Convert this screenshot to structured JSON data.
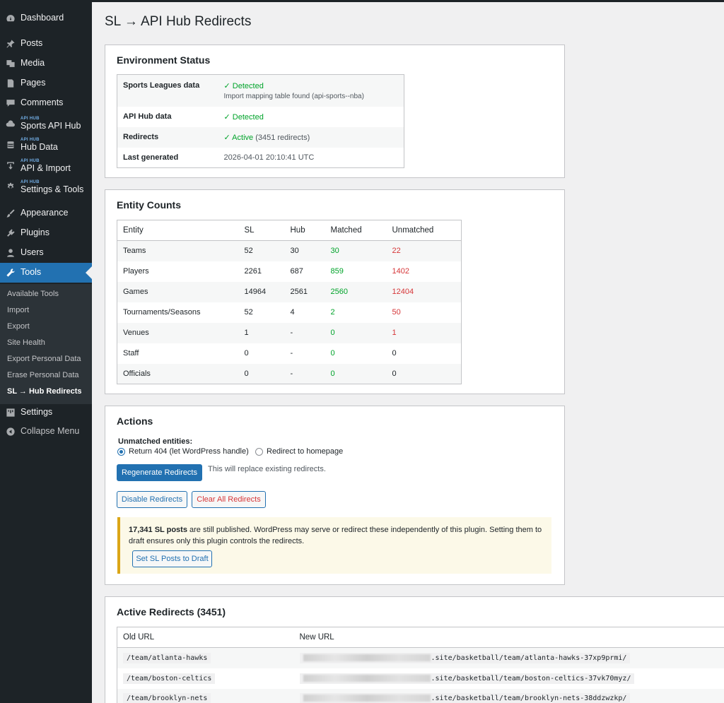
{
  "sidebar": {
    "items": [
      {
        "label": "Dashboard",
        "tag": "",
        "icon": "dashboard-icon"
      },
      {
        "label": "Posts",
        "tag": "",
        "icon": "pin-icon"
      },
      {
        "label": "Media",
        "tag": "",
        "icon": "media-icon"
      },
      {
        "label": "Pages",
        "tag": "",
        "icon": "page-icon"
      },
      {
        "label": "Comments",
        "tag": "",
        "icon": "comment-icon"
      },
      {
        "label": "Sports API Hub",
        "tag": "API HUB",
        "icon": "cloud-icon"
      },
      {
        "label": "Hub Data",
        "tag": "API HUB",
        "icon": "database-icon"
      },
      {
        "label": "API & Import",
        "tag": "API HUB",
        "icon": "download-icon"
      },
      {
        "label": "Settings & Tools",
        "tag": "API HUB",
        "icon": "gear-icon"
      },
      {
        "label": "Appearance",
        "tag": "",
        "icon": "brush-icon"
      },
      {
        "label": "Plugins",
        "tag": "",
        "icon": "plugin-icon"
      },
      {
        "label": "Users",
        "tag": "",
        "icon": "user-icon"
      },
      {
        "label": "Tools",
        "tag": "",
        "icon": "wrench-icon"
      },
      {
        "label": "Settings",
        "tag": "",
        "icon": "sliders-icon"
      },
      {
        "label": "Collapse Menu",
        "tag": "",
        "icon": "collapse-icon"
      }
    ],
    "submenu": [
      "Available Tools",
      "Import",
      "Export",
      "Site Health",
      "Export Personal Data",
      "Erase Personal Data",
      "SL → Hub Redirects"
    ]
  },
  "page": {
    "title": "SL → API Hub Redirects"
  },
  "environment": {
    "title": "Environment Status",
    "rows": [
      {
        "label": "Sports Leagues data",
        "value": "Detected",
        "note": "Import mapping table found (api-sports--nba)"
      },
      {
        "label": "API Hub data",
        "value": "Detected"
      },
      {
        "label": "Redirects",
        "value": "Active",
        "extra": "(3451 redirects)"
      },
      {
        "label": "Last generated",
        "value": "2026-04-01 20:10:41 UTC"
      }
    ]
  },
  "entity": {
    "title": "Entity Counts",
    "headers": [
      "Entity",
      "SL",
      "Hub",
      "Matched",
      "Unmatched"
    ],
    "rows": [
      [
        "Teams",
        "52",
        "30",
        "30",
        "22"
      ],
      [
        "Players",
        "2261",
        "687",
        "859",
        "1402"
      ],
      [
        "Games",
        "14964",
        "2561",
        "2560",
        "12404"
      ],
      [
        "Tournaments/Seasons",
        "52",
        "4",
        "2",
        "50"
      ],
      [
        "Venues",
        "1",
        "-",
        "0",
        "1"
      ],
      [
        "Staff",
        "0",
        "-",
        "0",
        "0"
      ],
      [
        "Officials",
        "0",
        "-",
        "0",
        "0"
      ]
    ]
  },
  "actions": {
    "title": "Actions",
    "unmatched_label": "Unmatched entities:",
    "radio_404": "Return 404 (let WordPress handle)",
    "radio_home": "Redirect to homepage",
    "regenerate": "Regenerate Redirects",
    "regenerate_note": "This will replace existing redirects.",
    "disable": "Disable Redirects",
    "clear": "Clear All Redirects",
    "notice_bold": "17,341 SL posts",
    "notice_text_1": "are still published. WordPress may serve or redirect these independently of this plugin. Setting them to",
    "notice_text_2": "draft ensures only this plugin controls the redirects.",
    "notice_button": "Set SL Posts to Draft"
  },
  "redirects": {
    "title": "Active Redirects (3451)",
    "headers": [
      "Old URL",
      "New URL"
    ],
    "rows": [
      {
        "old": "/team/atlanta-hawks",
        "new": ".site/basketball/team/atlanta-hawks-37xp9prmi/"
      },
      {
        "old": "/team/boston-celtics",
        "new": ".site/basketball/team/boston-celtics-37vk70myz/"
      },
      {
        "old": "/team/brooklyn-nets",
        "new": ".site/basketball/team/brooklyn-nets-38ddzwzkp/"
      }
    ]
  },
  "colors": {
    "accent": "#2271b1",
    "success": "#00a32a",
    "danger": "#d63638",
    "sidebar": "#1d2327",
    "notice_border": "#dba617"
  }
}
